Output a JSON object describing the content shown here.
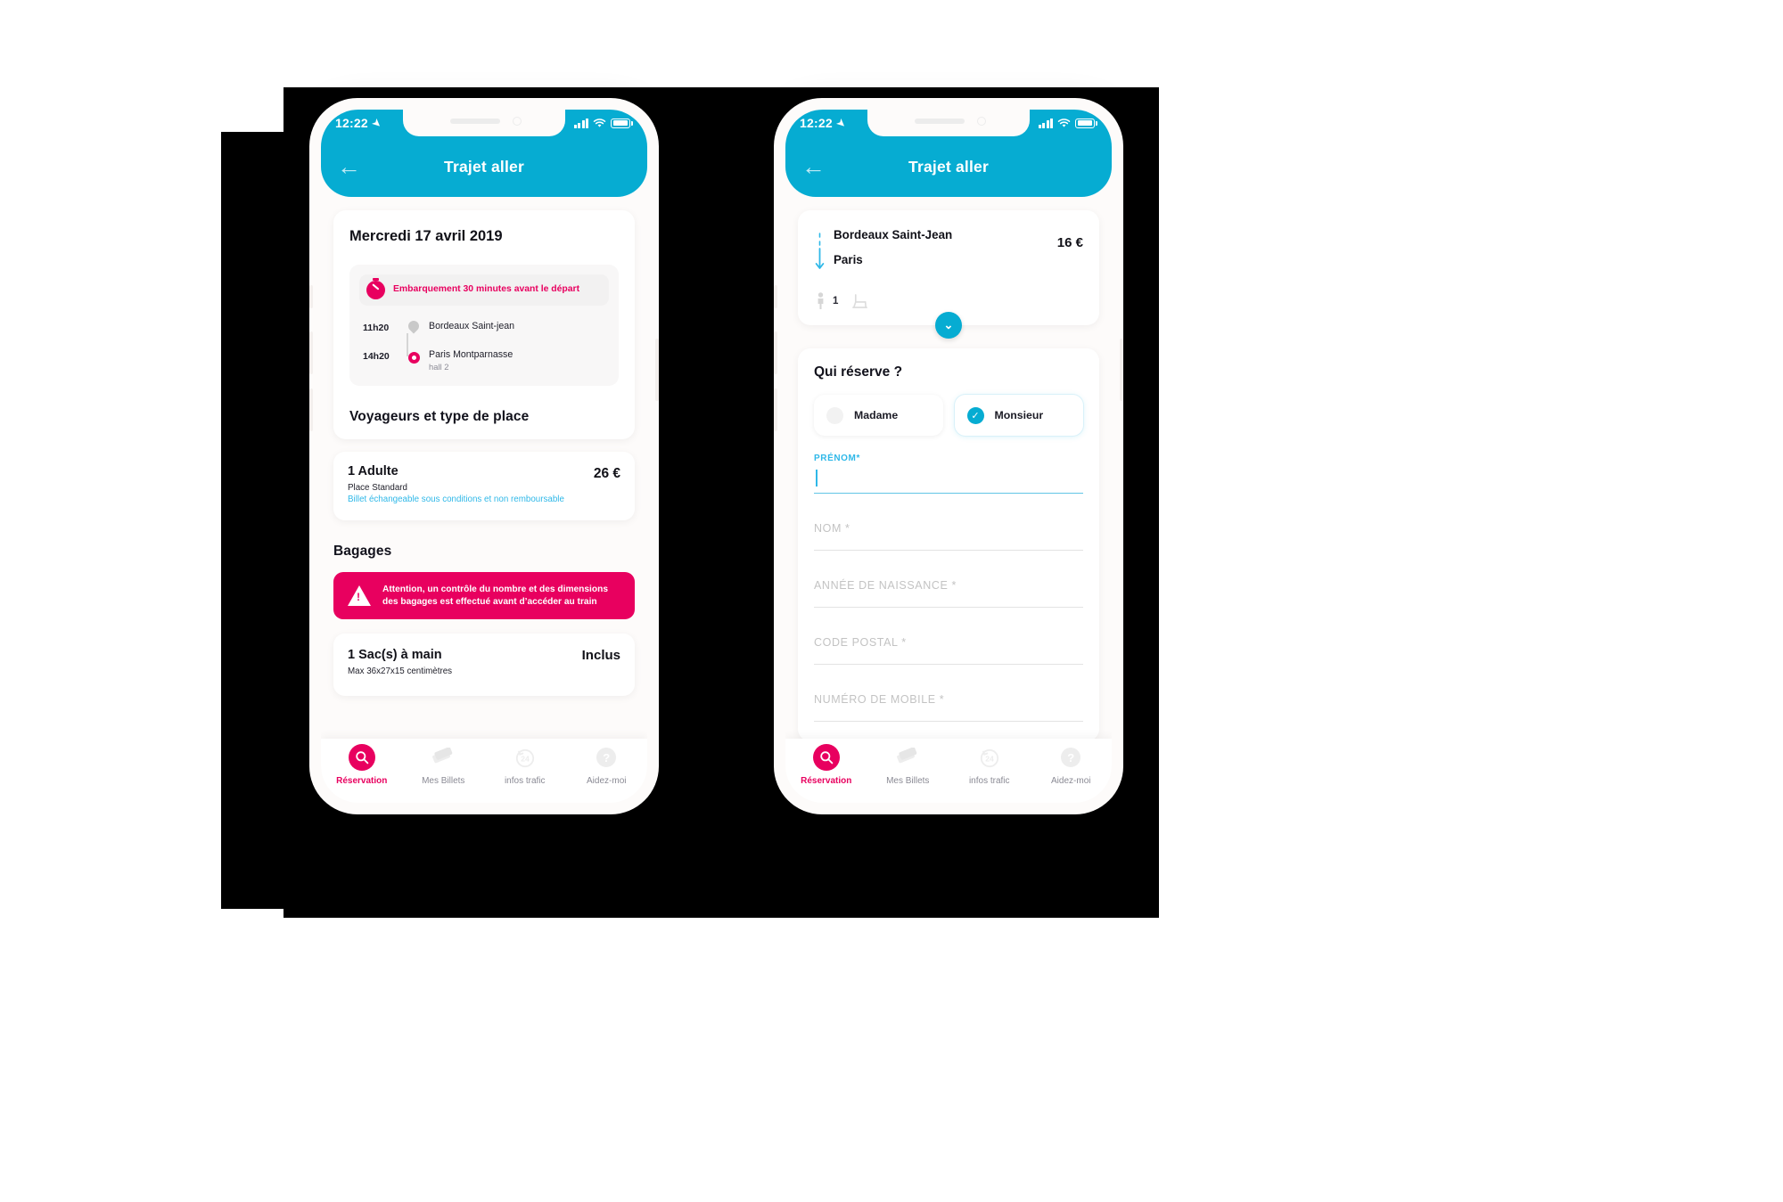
{
  "status_bar": {
    "time": "12:22",
    "location_icon": "location-arrow-icon",
    "signal_icon": "signal-bars-icon",
    "wifi_icon": "wifi-icon",
    "battery_icon": "battery-icon"
  },
  "nav": {
    "back_icon": "back-arrow-icon",
    "title": "Trajet aller"
  },
  "phone1": {
    "date_title": "Mercredi 17 avril 2019",
    "boarding": {
      "icon": "stopwatch-icon",
      "text": "Embarquement 30 minutes avant le départ"
    },
    "legs": [
      {
        "time": "11h20",
        "station": "Bordeaux Saint-jean",
        "detail": "",
        "pin": "map-pin-icon"
      },
      {
        "time": "14h20",
        "station": "Paris Montparnasse",
        "detail": "hall 2",
        "pin": "destination-ring-icon"
      }
    ],
    "travelers_section_title": "Voyageurs et type de place",
    "traveler": {
      "title": "1 Adulte",
      "place": "Place Standard",
      "conditions": "Billet échangeable sous conditions et non remboursable",
      "price": "26 €"
    },
    "baggage_section_title": "Bagages",
    "baggage_warning": {
      "icon": "warning-triangle-icon",
      "text": "Attention, un contrôle du nombre et des dimensions des bagages est effectué avant d’accéder au train"
    },
    "baggage_item": {
      "title": "1 Sac(s) à main",
      "sub": "Max 36x27x15 centimètres",
      "value": "Inclus"
    }
  },
  "phone2": {
    "summary": {
      "origin": "Bordeaux Saint-Jean",
      "destination": "Paris",
      "price": "16 €",
      "arrow_icon": "down-arrow-icon",
      "passenger_icon": "passenger-icon",
      "passenger_count": "1",
      "seat_icon": "seat-icon",
      "expand_icon": "chevron-down-icon"
    },
    "form": {
      "title": "Qui réserve ?",
      "options": [
        {
          "label": "Madame",
          "selected": false
        },
        {
          "label": "Monsieur",
          "selected": true
        }
      ],
      "check_icon": "check-icon",
      "fields": [
        {
          "label": "PRÉNOM*",
          "value": "",
          "state": "focused"
        },
        {
          "placeholder": "NOM *",
          "value": "",
          "state": "empty"
        },
        {
          "placeholder": "ANNÉE DE NAISSANCE *",
          "value": "",
          "state": "empty"
        },
        {
          "placeholder": "CODE POSTAL *",
          "value": "",
          "state": "empty"
        },
        {
          "placeholder": "NUMÉRO DE MOBILE *",
          "value": "",
          "state": "empty"
        }
      ]
    }
  },
  "tabbar": {
    "items": [
      {
        "label": "Réservation",
        "icon": "search-icon",
        "active": true
      },
      {
        "label": "Mes Billets",
        "icon": "tickets-icon",
        "active": false
      },
      {
        "label": "infos trafic",
        "icon": "24h-clock-icon",
        "active": false
      },
      {
        "label": "Aidez-moi",
        "icon": "question-mark-icon",
        "active": false
      }
    ]
  },
  "colors": {
    "teal": "#06ACD2",
    "pink": "#E8005F",
    "light_blue": "#2FB8E8",
    "screen_bg": "#fdfbfa"
  }
}
